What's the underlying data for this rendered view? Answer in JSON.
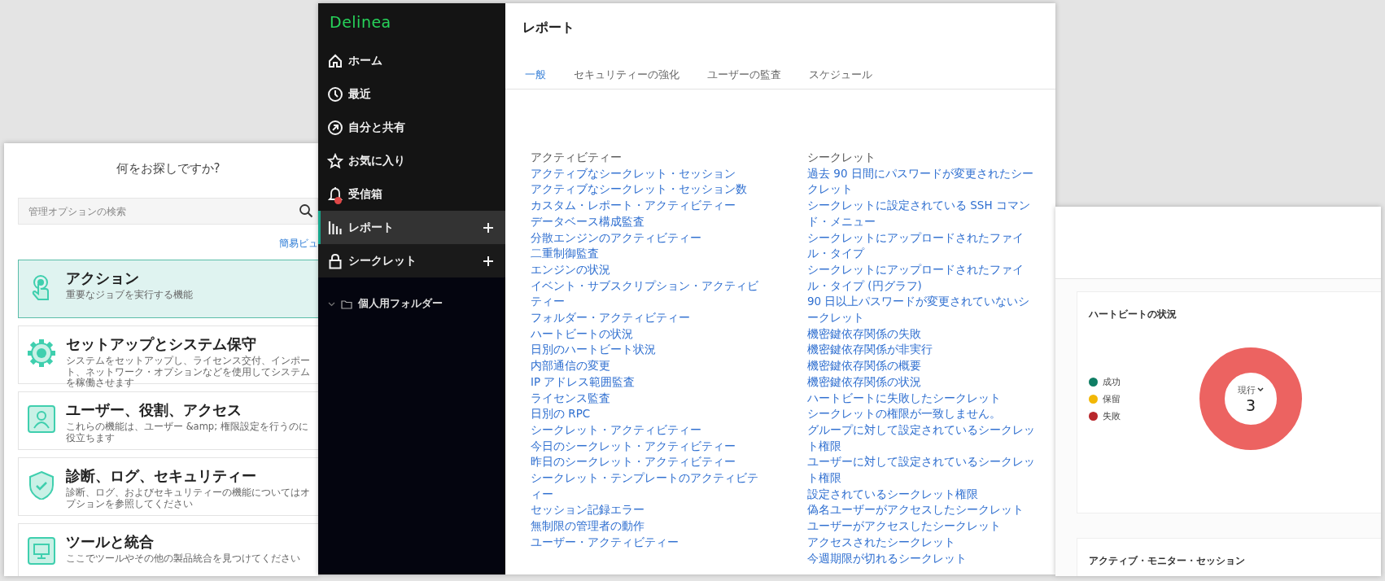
{
  "admin_panel": {
    "title": "何をお探しですか?",
    "search": {
      "placeholder": "管理オプションの検索"
    },
    "link": "簡易ビュ",
    "categories": [
      {
        "title": "アクション",
        "description": "重要なジョブを実行する機能",
        "selected": true
      },
      {
        "title": "セットアップとシステム保守",
        "description": "システムをセットアップし、ライセンス交付、インポート、ネットワーク・オプションなどを使用してシステムを稼働させます",
        "selected": false
      },
      {
        "title": "ユーザー、役割、アクセス",
        "description": "これらの機能は、ユーザー &amp; 権限設定を行うのに役立ちます",
        "selected": false
      },
      {
        "title": "診断、ログ、セキュリティー",
        "description": "診断、ログ、およびセキュリティーの機能についてはオプションを参照してください",
        "selected": false
      },
      {
        "title": "ツールと統合",
        "description": "ここでツールやその他の製品統合を見つけてください",
        "selected": false
      }
    ]
  },
  "app": {
    "logo": "Delinea",
    "nav": [
      {
        "label": "ホーム",
        "selected": false,
        "add": false,
        "unread": false
      },
      {
        "label": "最近",
        "selected": false,
        "add": false,
        "unread": false
      },
      {
        "label": "自分と共有",
        "selected": false,
        "add": false,
        "unread": false
      },
      {
        "label": "お気に入り",
        "selected": false,
        "add": false,
        "unread": false
      },
      {
        "label": "受信箱",
        "selected": false,
        "add": false,
        "unread": true
      },
      {
        "label": "レポート",
        "selected": true,
        "add": true,
        "unread": false
      },
      {
        "label": "シークレット",
        "selected": false,
        "add": true,
        "unread": false
      }
    ],
    "folders": [
      {
        "label": "個人用フォルダー"
      }
    ],
    "page_title": "レポート",
    "tabs": [
      {
        "label": "一般",
        "selected": true
      },
      {
        "label": "セキュリティーの強化",
        "selected": false
      },
      {
        "label": "ユーザーの監査",
        "selected": false
      },
      {
        "label": "スケジュール",
        "selected": false
      }
    ],
    "report_groups": [
      {
        "heading": "アクティビティー",
        "items": [
          "アクティブなシークレット・セッション",
          "アクティブなシークレット・セッション数",
          "カスタム・レポート・アクティビティー",
          "データベース構成監査",
          "分散エンジンのアクティビティー",
          "二重制御監査",
          "エンジンの状況",
          "イベント・サブスクリプション・アクティビティー",
          "フォルダー・アクティビティー",
          "ハートビートの状況",
          "日別のハートビート状況",
          "内部通信の変更",
          "IP アドレス範囲監査",
          "ライセンス監査",
          "日別の RPC",
          "シークレット・アクティビティー",
          "今日のシークレット・アクティビティー",
          "昨日のシークレット・アクティビティー",
          "シークレット・テンプレートのアクティビティー",
          "セッション記録エラー",
          "無制限の管理者の動作",
          "ユーザー・アクティビティー"
        ]
      },
      {
        "heading": "シークレット",
        "items": [
          "過去 90 日間にパスワードが変更されたシークレット",
          "シークレットに設定されている SSH コマンド・メニュー",
          "シークレットにアップロードされたファイル・タイプ",
          "シークレットにアップロードされたファイル・タイプ (円グラフ)",
          "90 日以上パスワードが変更されていないシークレット",
          "機密鍵依存関係の失敗",
          "機密鍵依存関係が非実行",
          "機密鍵依存関係の概要",
          "機密鍵依存関係の状況",
          "ハートビートに失敗したシークレット",
          "シークレットの権限が一致しません。",
          "グループに対して設定されているシークレット権限",
          "ユーザーに対して設定されているシークレット権限",
          "設定されているシークレット権限",
          "偽名ユーザーがアクセスしたシークレット",
          "ユーザーがアクセスしたシークレット",
          "アクセスされたシークレット",
          "今週期限が切れるシークレット"
        ]
      }
    ]
  },
  "dashboard": {
    "widgets": [
      {
        "kind": "donut",
        "title": "ハートビートの状況",
        "legend": [
          {
            "label": "成功",
            "color": "#0f7d64"
          },
          {
            "label": "保留",
            "color": "#f2b705"
          },
          {
            "label": "失敗",
            "color": "#b8262b"
          }
        ],
        "center_label": "現行",
        "center_value": "3"
      },
      {
        "kind": "empty",
        "title": "アクティブ・モニター・セッション"
      }
    ]
  }
}
